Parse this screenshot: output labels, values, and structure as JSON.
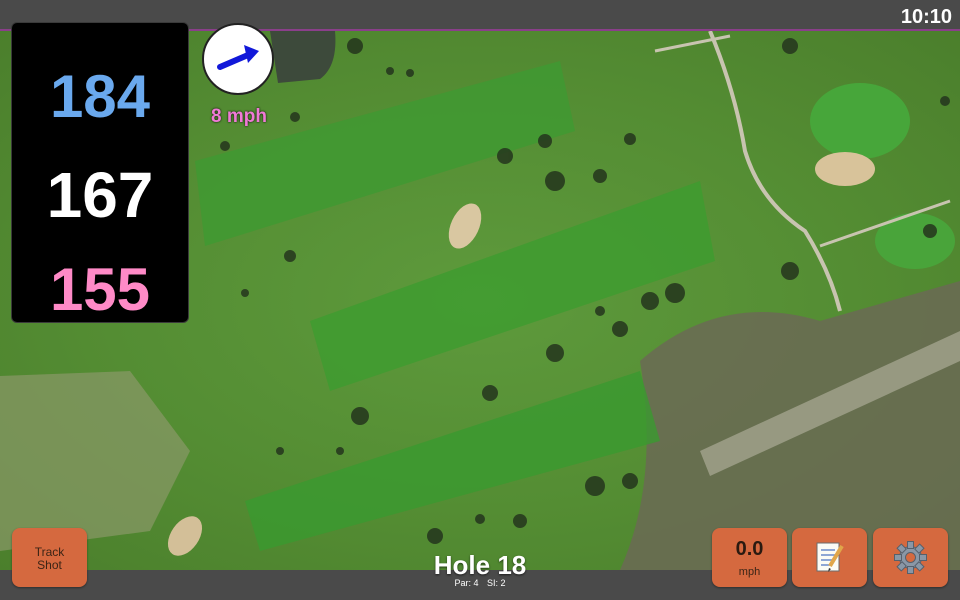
{
  "status": {
    "time": "10:10"
  },
  "distances": {
    "back": "184",
    "middle": "167",
    "front": "155"
  },
  "wind": {
    "speed": "8 mph",
    "icon": "wind-arrow-icon"
  },
  "buttons": {
    "track_shot": "Track\nShot",
    "speed_value": "0.0",
    "speed_unit": "mph",
    "notes_icon": "notepad-icon",
    "settings_icon": "gear-icon"
  },
  "hole": {
    "title": "Hole 18",
    "par": "Par: 4",
    "si": "SI: 2"
  },
  "colors": {
    "back": "#6aa9ee",
    "middle": "#ffffff",
    "front": "#ff8ac7",
    "button": "#d5693f",
    "wind": "#f07ad6"
  }
}
